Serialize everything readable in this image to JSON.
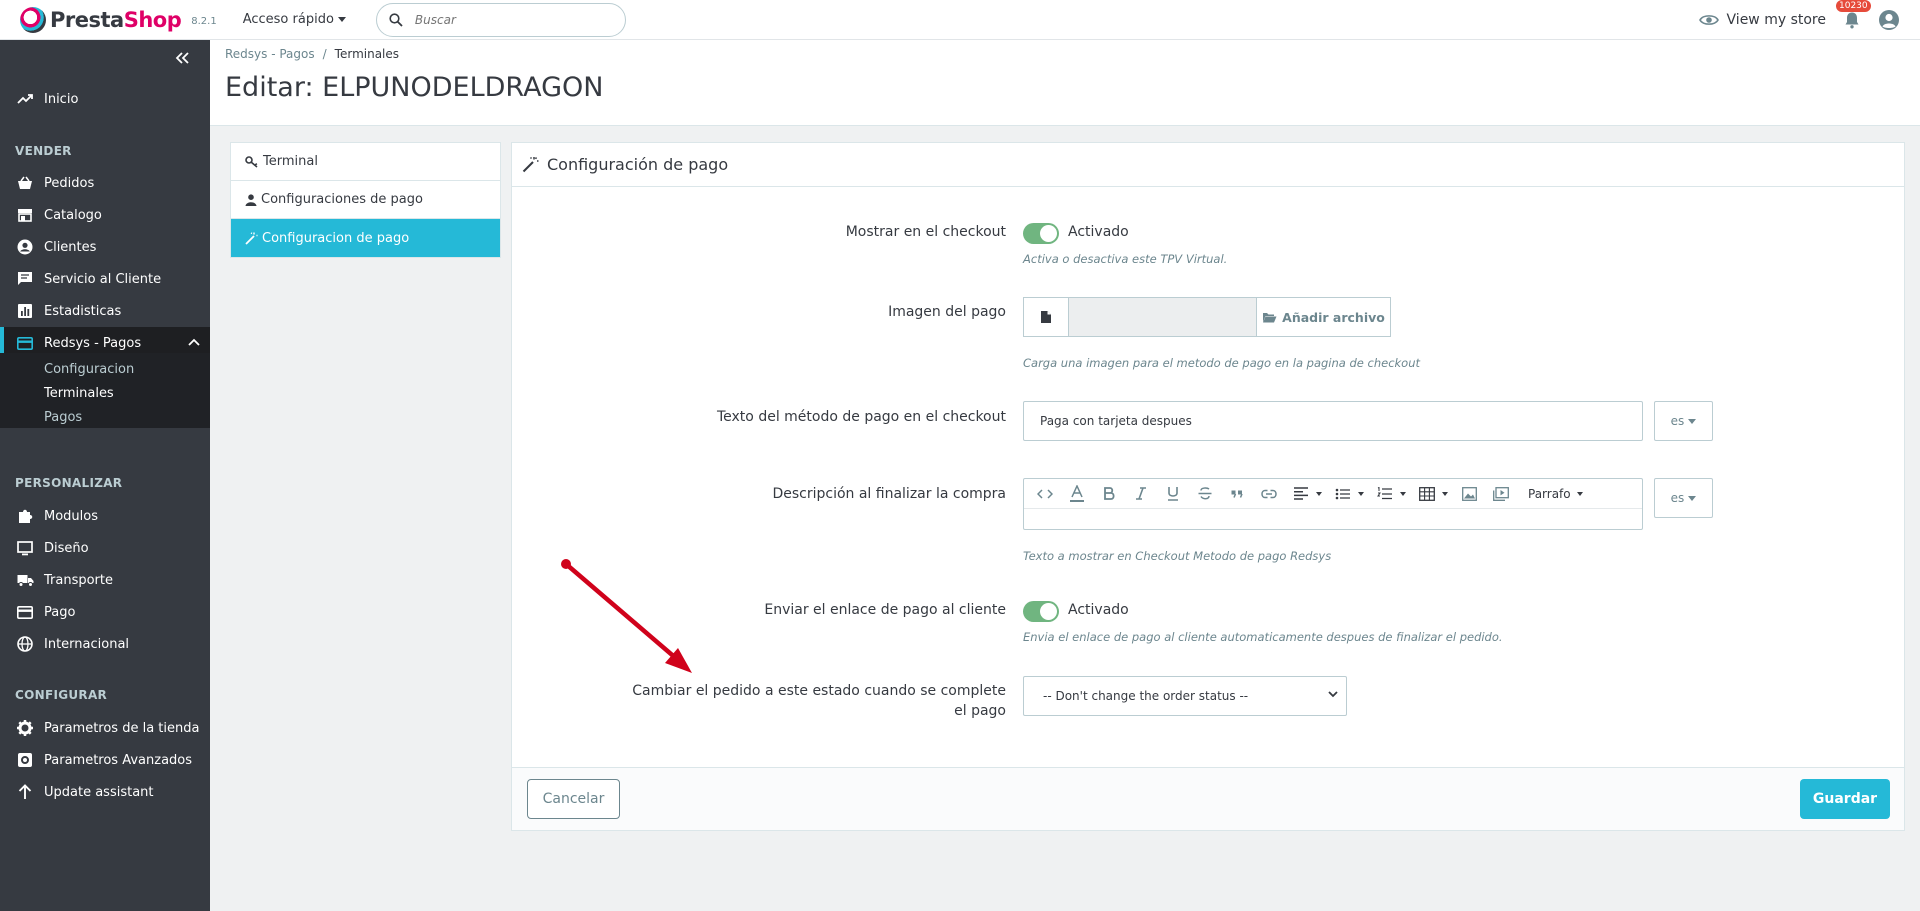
{
  "header": {
    "logo_prefix": "Presta",
    "logo_suffix": "Shop",
    "version": "8.2.1",
    "quick_access": "Acceso rápido",
    "search_placeholder": "Buscar",
    "view_store": "View my store",
    "notifications_count": "10230"
  },
  "sidebar": {
    "home": "Inicio",
    "sections": {
      "sell": "VENDER",
      "customize": "PERSONALIZAR",
      "configure": "CONFIGURAR"
    },
    "sell_items": [
      "Pedidos",
      "Catalogo",
      "Clientes",
      "Servicio al Cliente",
      "Estadisticas",
      "Redsys - Pagos"
    ],
    "redsys_sub": [
      "Configuracion",
      "Terminales",
      "Pagos"
    ],
    "customize_items": [
      "Modulos",
      "Diseño",
      "Transporte",
      "Pago",
      "Internacional"
    ],
    "configure_items": [
      "Parametros de la tienda",
      "Parametros Avanzados",
      "Update assistant"
    ]
  },
  "page": {
    "breadcrumb": [
      "Redsys - Pagos",
      "/",
      "Terminales"
    ],
    "title": "Editar: ELPUNODELDRAGON"
  },
  "tabs": [
    "Terminal",
    "Configuraciones de pago",
    "Configuracion de pago"
  ],
  "panel": {
    "heading": "Configuración de pago",
    "fields": {
      "show_checkout": {
        "label": "Mostrar en el checkout",
        "state": "Activado",
        "help": "Activa o desactiva este TPV Virtual."
      },
      "payment_image": {
        "label": "Imagen del pago",
        "button": "Añadir archivo",
        "help": "Carga una imagen para el metodo de pago en la pagina de checkout"
      },
      "method_text": {
        "label": "Texto del método de pago en el checkout",
        "value": "Paga con tarjeta despues",
        "lang": "es"
      },
      "description": {
        "label": "Descripción al finalizar la compra",
        "paragraph": "Parrafo",
        "lang": "es",
        "help": "Texto a mostrar en Checkout Metodo de pago Redsys"
      },
      "send_link": {
        "label": "Enviar el enlace de pago al cliente",
        "state": "Activado",
        "help": "Envia el enlace de pago al cliente automaticamente despues de finalizar el pedido."
      },
      "change_status": {
        "label_line1": "Cambiar el pedido a este estado cuando se complete",
        "label_line2": "el pago",
        "selected": "-- Don't change the order status --"
      }
    },
    "cancel": "Cancelar",
    "save": "Guardar"
  },
  "colors": {
    "accent": "#25b9d7",
    "sidebar_bg": "#363a41",
    "switch_on": "#70b580",
    "brand_pink": "#df0067",
    "annotation_arrow": "#d0021b"
  }
}
